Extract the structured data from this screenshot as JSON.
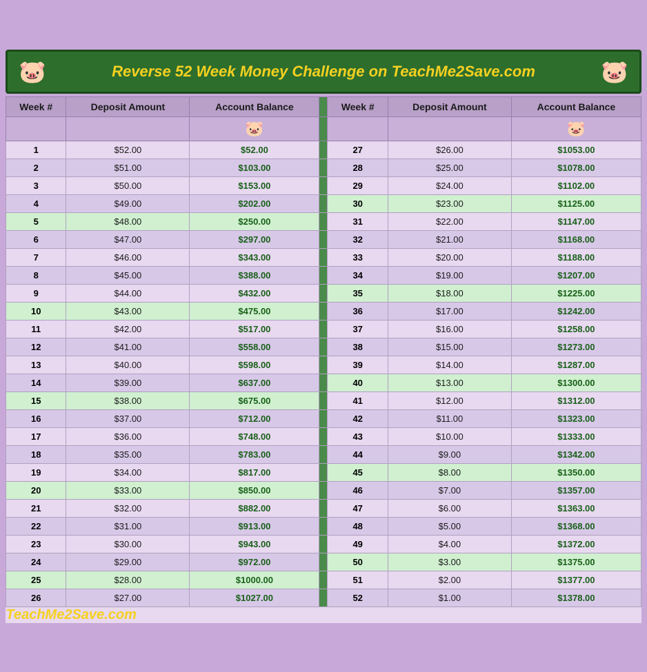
{
  "title": "Reverse 52 Week Money Challenge on TeachMe2Save.com",
  "footer": "TeachMe2Save.com",
  "headers": {
    "week": "Week #",
    "deposit": "Deposit Amount",
    "balance": "Account Balance"
  },
  "pig_emoji": "🐷",
  "left_data": [
    {
      "week": 1,
      "deposit": "$52.00",
      "balance": "$52.00"
    },
    {
      "week": 2,
      "deposit": "$51.00",
      "balance": "$103.00"
    },
    {
      "week": 3,
      "deposit": "$50.00",
      "balance": "$153.00"
    },
    {
      "week": 4,
      "deposit": "$49.00",
      "balance": "$202.00"
    },
    {
      "week": 5,
      "deposit": "$48.00",
      "balance": "$250.00"
    },
    {
      "week": 6,
      "deposit": "$47.00",
      "balance": "$297.00"
    },
    {
      "week": 7,
      "deposit": "$46.00",
      "balance": "$343.00"
    },
    {
      "week": 8,
      "deposit": "$45.00",
      "balance": "$388.00"
    },
    {
      "week": 9,
      "deposit": "$44.00",
      "balance": "$432.00"
    },
    {
      "week": 10,
      "deposit": "$43.00",
      "balance": "$475.00"
    },
    {
      "week": 11,
      "deposit": "$42.00",
      "balance": "$517.00"
    },
    {
      "week": 12,
      "deposit": "$41.00",
      "balance": "$558.00"
    },
    {
      "week": 13,
      "deposit": "$40.00",
      "balance": "$598.00"
    },
    {
      "week": 14,
      "deposit": "$39.00",
      "balance": "$637.00"
    },
    {
      "week": 15,
      "deposit": "$38.00",
      "balance": "$675.00"
    },
    {
      "week": 16,
      "deposit": "$37.00",
      "balance": "$712.00"
    },
    {
      "week": 17,
      "deposit": "$36.00",
      "balance": "$748.00"
    },
    {
      "week": 18,
      "deposit": "$35.00",
      "balance": "$783.00"
    },
    {
      "week": 19,
      "deposit": "$34.00",
      "balance": "$817.00"
    },
    {
      "week": 20,
      "deposit": "$33.00",
      "balance": "$850.00"
    },
    {
      "week": 21,
      "deposit": "$32.00",
      "balance": "$882.00"
    },
    {
      "week": 22,
      "deposit": "$31.00",
      "balance": "$913.00"
    },
    {
      "week": 23,
      "deposit": "$30.00",
      "balance": "$943.00"
    },
    {
      "week": 24,
      "deposit": "$29.00",
      "balance": "$972.00"
    },
    {
      "week": 25,
      "deposit": "$28.00",
      "balance": "$1000.00"
    },
    {
      "week": 26,
      "deposit": "$27.00",
      "balance": "$1027.00"
    }
  ],
  "right_data": [
    {
      "week": 27,
      "deposit": "$26.00",
      "balance": "$1053.00"
    },
    {
      "week": 28,
      "deposit": "$25.00",
      "balance": "$1078.00"
    },
    {
      "week": 29,
      "deposit": "$24.00",
      "balance": "$1102.00"
    },
    {
      "week": 30,
      "deposit": "$23.00",
      "balance": "$1125.00"
    },
    {
      "week": 31,
      "deposit": "$22.00",
      "balance": "$1147.00"
    },
    {
      "week": 32,
      "deposit": "$21.00",
      "balance": "$1168.00"
    },
    {
      "week": 33,
      "deposit": "$20.00",
      "balance": "$1188.00"
    },
    {
      "week": 34,
      "deposit": "$19.00",
      "balance": "$1207.00"
    },
    {
      "week": 35,
      "deposit": "$18.00",
      "balance": "$1225.00"
    },
    {
      "week": 36,
      "deposit": "$17.00",
      "balance": "$1242.00"
    },
    {
      "week": 37,
      "deposit": "$16.00",
      "balance": "$1258.00"
    },
    {
      "week": 38,
      "deposit": "$15.00",
      "balance": "$1273.00"
    },
    {
      "week": 39,
      "deposit": "$14.00",
      "balance": "$1287.00"
    },
    {
      "week": 40,
      "deposit": "$13.00",
      "balance": "$1300.00"
    },
    {
      "week": 41,
      "deposit": "$12.00",
      "balance": "$1312.00"
    },
    {
      "week": 42,
      "deposit": "$11.00",
      "balance": "$1323.00"
    },
    {
      "week": 43,
      "deposit": "$10.00",
      "balance": "$1333.00"
    },
    {
      "week": 44,
      "deposit": "$9.00",
      "balance": "$1342.00"
    },
    {
      "week": 45,
      "deposit": "$8.00",
      "balance": "$1350.00"
    },
    {
      "week": 46,
      "deposit": "$7.00",
      "balance": "$1357.00"
    },
    {
      "week": 47,
      "deposit": "$6.00",
      "balance": "$1363.00"
    },
    {
      "week": 48,
      "deposit": "$5.00",
      "balance": "$1368.00"
    },
    {
      "week": 49,
      "deposit": "$4.00",
      "balance": "$1372.00"
    },
    {
      "week": 50,
      "deposit": "$3.00",
      "balance": "$1375.00"
    },
    {
      "week": 51,
      "deposit": "$2.00",
      "balance": "$1377.00"
    },
    {
      "week": 52,
      "deposit": "$1.00",
      "balance": "$1378.00"
    }
  ]
}
